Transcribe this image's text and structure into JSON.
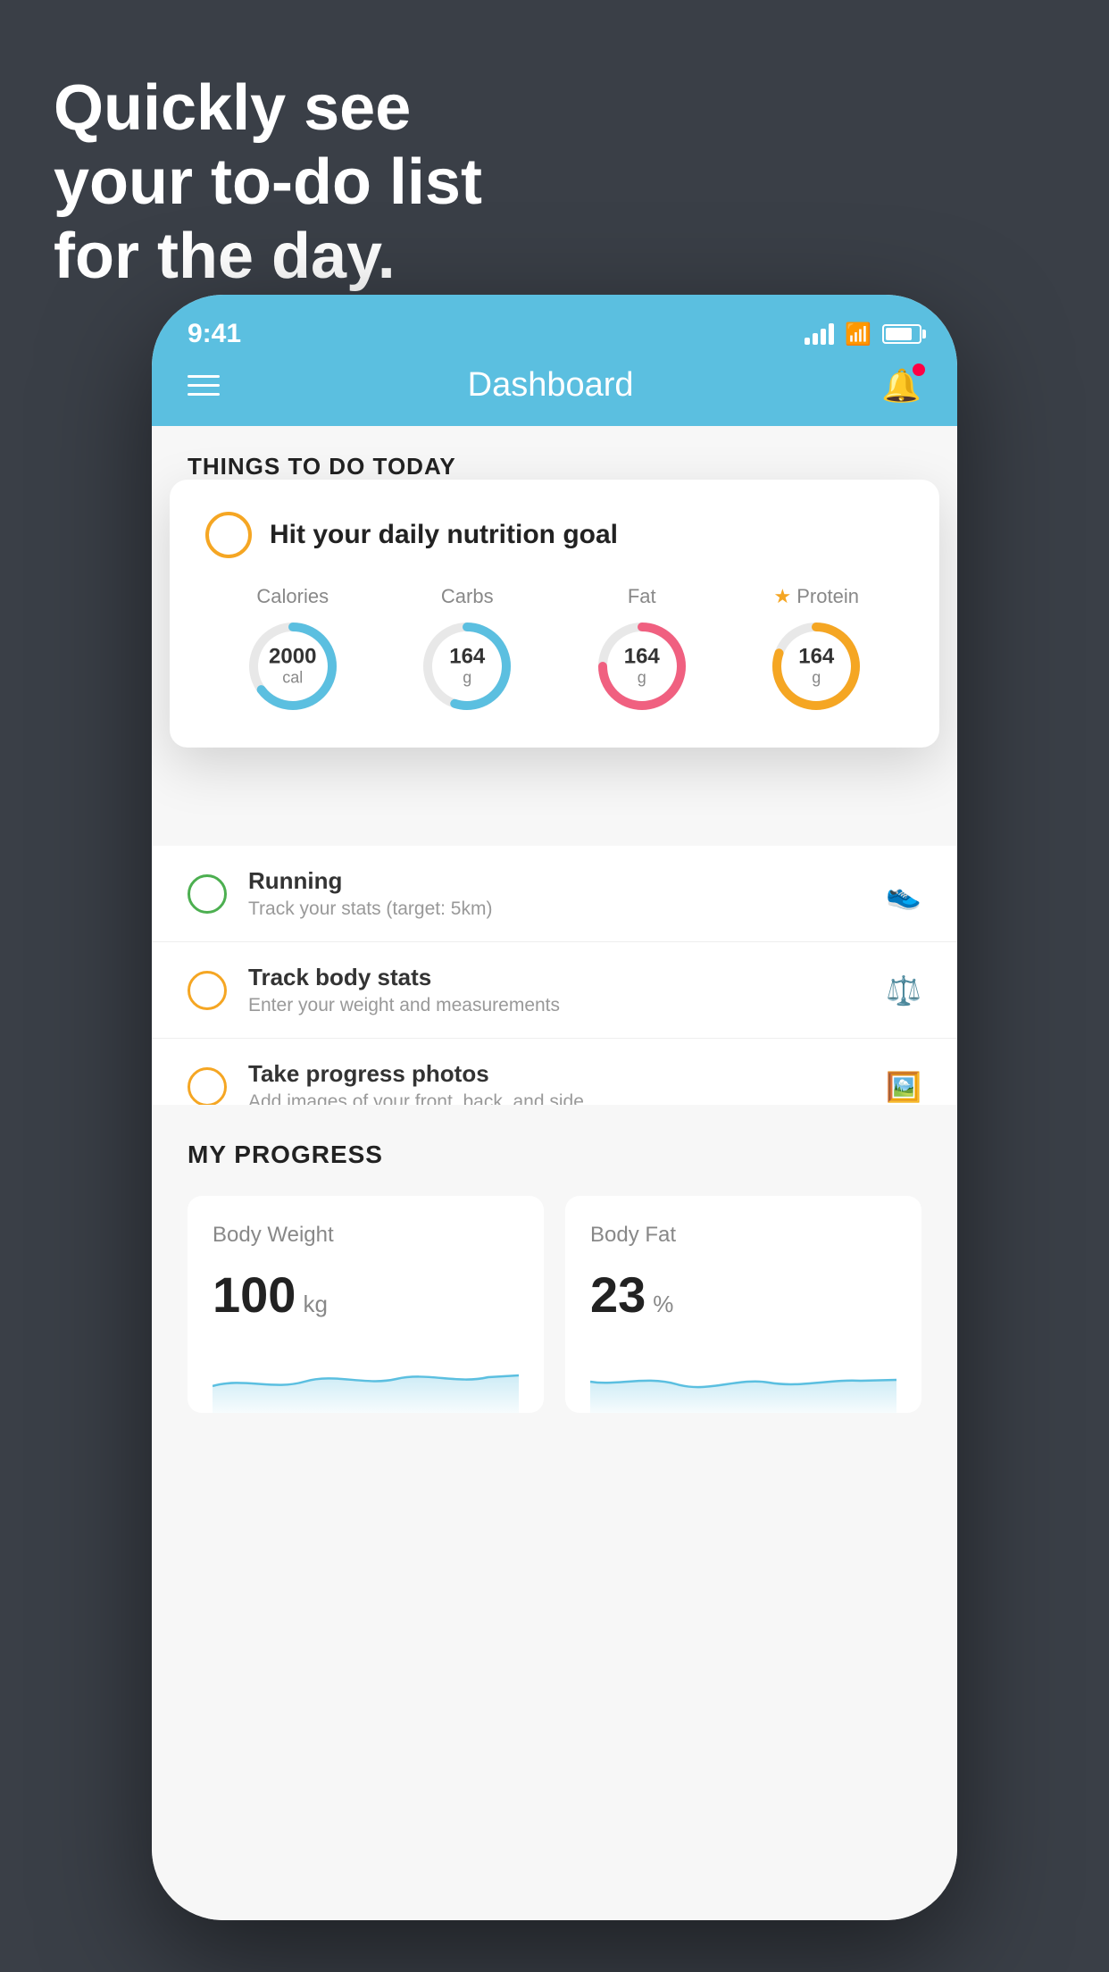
{
  "headline": {
    "line1": "Quickly see",
    "line2": "your to-do list",
    "line3": "for the day."
  },
  "statusBar": {
    "time": "9:41",
    "battery": "80"
  },
  "header": {
    "title": "Dashboard"
  },
  "section": {
    "todayLabel": "THINGS TO DO TODAY"
  },
  "nutritionCard": {
    "title": "Hit your daily nutrition goal",
    "macros": [
      {
        "label": "Calories",
        "value": "2000",
        "unit": "cal",
        "color": "#5bbfe0",
        "percent": 65,
        "star": false
      },
      {
        "label": "Carbs",
        "value": "164",
        "unit": "g",
        "color": "#5bbfe0",
        "percent": 55,
        "star": false
      },
      {
        "label": "Fat",
        "value": "164",
        "unit": "g",
        "color": "#f06080",
        "percent": 75,
        "star": false
      },
      {
        "label": "Protein",
        "value": "164",
        "unit": "g",
        "color": "#f5a623",
        "percent": 80,
        "star": true
      }
    ]
  },
  "todoItems": [
    {
      "title": "Running",
      "subtitle": "Track your stats (target: 5km)",
      "circleColor": "green",
      "icon": "shoe"
    },
    {
      "title": "Track body stats",
      "subtitle": "Enter your weight and measurements",
      "circleColor": "yellow",
      "icon": "scale"
    },
    {
      "title": "Take progress photos",
      "subtitle": "Add images of your front, back, and side",
      "circleColor": "yellow",
      "icon": "photo"
    }
  ],
  "progress": {
    "sectionTitle": "MY PROGRESS",
    "cards": [
      {
        "title": "Body Weight",
        "value": "100",
        "unit": "kg"
      },
      {
        "title": "Body Fat",
        "value": "23",
        "unit": "%"
      }
    ]
  }
}
